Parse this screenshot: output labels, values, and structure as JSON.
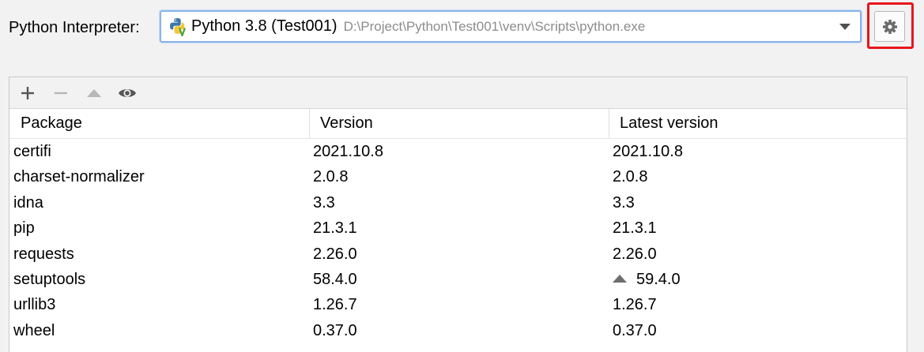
{
  "interpreter": {
    "label": "Python Interpreter:",
    "name": "Python 3.8 (Test001)",
    "path": "D:\\Project\\Python\\Test001\\venv\\Scripts\\python.exe"
  },
  "toolbar": {
    "add_icon": "plus-icon",
    "remove_icon": "minus-icon",
    "upgrade_icon": "triangle-up-icon",
    "show_early_releases_icon": "eye-icon",
    "settings_icon": "gear-icon"
  },
  "table": {
    "columns": [
      "Package",
      "Version",
      "Latest version"
    ],
    "rows": [
      {
        "package": "certifi",
        "version": "2021.10.8",
        "latest": "2021.10.8",
        "upgrade": false
      },
      {
        "package": "charset-normalizer",
        "version": "2.0.8",
        "latest": "2.0.8",
        "upgrade": false
      },
      {
        "package": "idna",
        "version": "3.3",
        "latest": "3.3",
        "upgrade": false
      },
      {
        "package": "pip",
        "version": "21.3.1",
        "latest": "21.3.1",
        "upgrade": false
      },
      {
        "package": "requests",
        "version": "2.26.0",
        "latest": "2.26.0",
        "upgrade": false
      },
      {
        "package": "setuptools",
        "version": "58.4.0",
        "latest": "59.4.0",
        "upgrade": true
      },
      {
        "package": "urllib3",
        "version": "1.26.7",
        "latest": "1.26.7",
        "upgrade": false
      },
      {
        "package": "wheel",
        "version": "0.37.0",
        "latest": "0.37.0",
        "upgrade": false
      }
    ]
  },
  "colors": {
    "highlight_border": "#e8151b",
    "focus_border": "#8ab4e8",
    "path_text": "#8c8c8c"
  }
}
